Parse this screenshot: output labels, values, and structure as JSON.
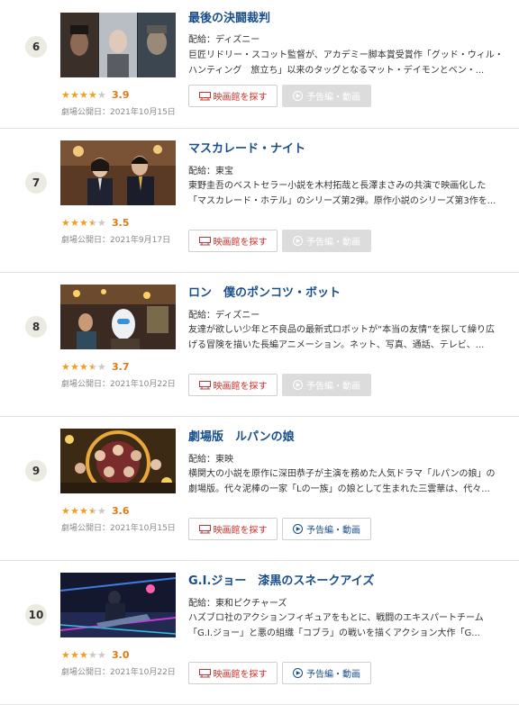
{
  "labels": {
    "theater_button": "映画館を探す",
    "trailer_button": "予告編・動画"
  },
  "colors": {
    "title": "#1a4e8a",
    "theater_button": "#d0302b",
    "score": "#e07a12",
    "star_on": "#f0a020",
    "star_off": "#c9c9c9",
    "rank_badge_bg": "#ecebe1"
  },
  "items": [
    {
      "rank": "6",
      "title": "最後の決闘裁判",
      "distributor": "配給：ディズニー",
      "synopsis": "巨匠リドリー・スコット監督が、アカデミー脚本賞受賞作「グッド・ウィル・ハンティング　旅立ち」以来のタッグとなるマット・デイモンとベン・...",
      "score": "3.9",
      "stars": 4,
      "release": "劇場公開日：2021年10月15日",
      "trailer_available": false,
      "thumb_icon": "movie-still-three-faces"
    },
    {
      "rank": "7",
      "title": "マスカレード・ナイト",
      "distributor": "配給：東宝",
      "synopsis": "東野圭吾のベストセラー小説を木村拓哉と長澤まさみの共演で映画化した「マスカレード・ホテル」のシリーズ第2弾。原作小説のシリーズ第3作を...",
      "score": "3.5",
      "stars": 3.5,
      "release": "劇場公開日：2021年9月17日",
      "trailer_available": false,
      "thumb_icon": "movie-still-hotel-staff"
    },
    {
      "rank": "8",
      "title": "ロン　僕のポンコツ・ボット",
      "distributor": "配給：ディズニー",
      "synopsis": "友達が欲しい少年と不良品の最新式ロボットが“本当の友情”を探して繰り広げる冒険を描いた長編アニメーション。ネット、写真、通話、テレビ、...",
      "score": "3.7",
      "stars": 3.5,
      "release": "劇場公開日：2021年10月22日",
      "trailer_available": false,
      "thumb_icon": "movie-still-robot"
    },
    {
      "rank": "9",
      "title": "劇場版　ルパンの娘",
      "distributor": "配給：東映",
      "synopsis": "横関大の小説を原作に深田恭子が主演を務めた人気ドラマ「ルパンの娘」の劇場版。代々泥棒の一家「Lの一族」の娘として生まれた三雲華は、代々...",
      "score": "3.6",
      "stars": 3.5,
      "release": "劇場公開日：2021年10月15日",
      "trailer_available": true,
      "thumb_icon": "movie-still-ensemble"
    },
    {
      "rank": "10",
      "title": "G.I.ジョー　漆黒のスネークアイズ",
      "distributor": "配給：東和ピクチャーズ",
      "synopsis": "ハズブロ社のアクションフィギュアをもとに、戦闘のエキスパートチーム「G.I.ジョー」と悪の組織「コブラ」の戦いを描くアクション大作「G...",
      "score": "3.0",
      "stars": 3,
      "release": "劇場公開日：2021年10月22日",
      "trailer_available": true,
      "thumb_icon": "movie-still-action"
    }
  ]
}
